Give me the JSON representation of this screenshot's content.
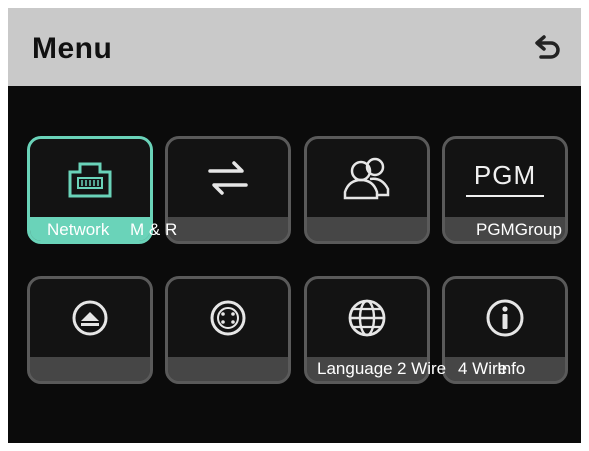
{
  "header": {
    "title": "Menu",
    "back_icon": "back-arrow-icon"
  },
  "tiles": [
    {
      "icon": "ethernet-port-icon",
      "active": true
    },
    {
      "icon": "swap-arrows-icon"
    },
    {
      "icon": "users-icon"
    },
    {
      "icon": "pgm-icon",
      "icon_text": "PGM"
    },
    {
      "icon": "eject-icon"
    },
    {
      "icon": "connector-icon"
    },
    {
      "icon": "globe-icon"
    },
    {
      "icon": "info-icon"
    }
  ],
  "labels": {
    "network": "Network",
    "m_and_r": "M & R",
    "pgm_group": "PGMGroup",
    "language": "Language",
    "two_wire": "2 Wire",
    "four_wire": "4 Wire",
    "info": "Info"
  },
  "colors": {
    "active": "#6ad3b9",
    "header": "#c9c9c9",
    "background": "#0b0b0b"
  }
}
